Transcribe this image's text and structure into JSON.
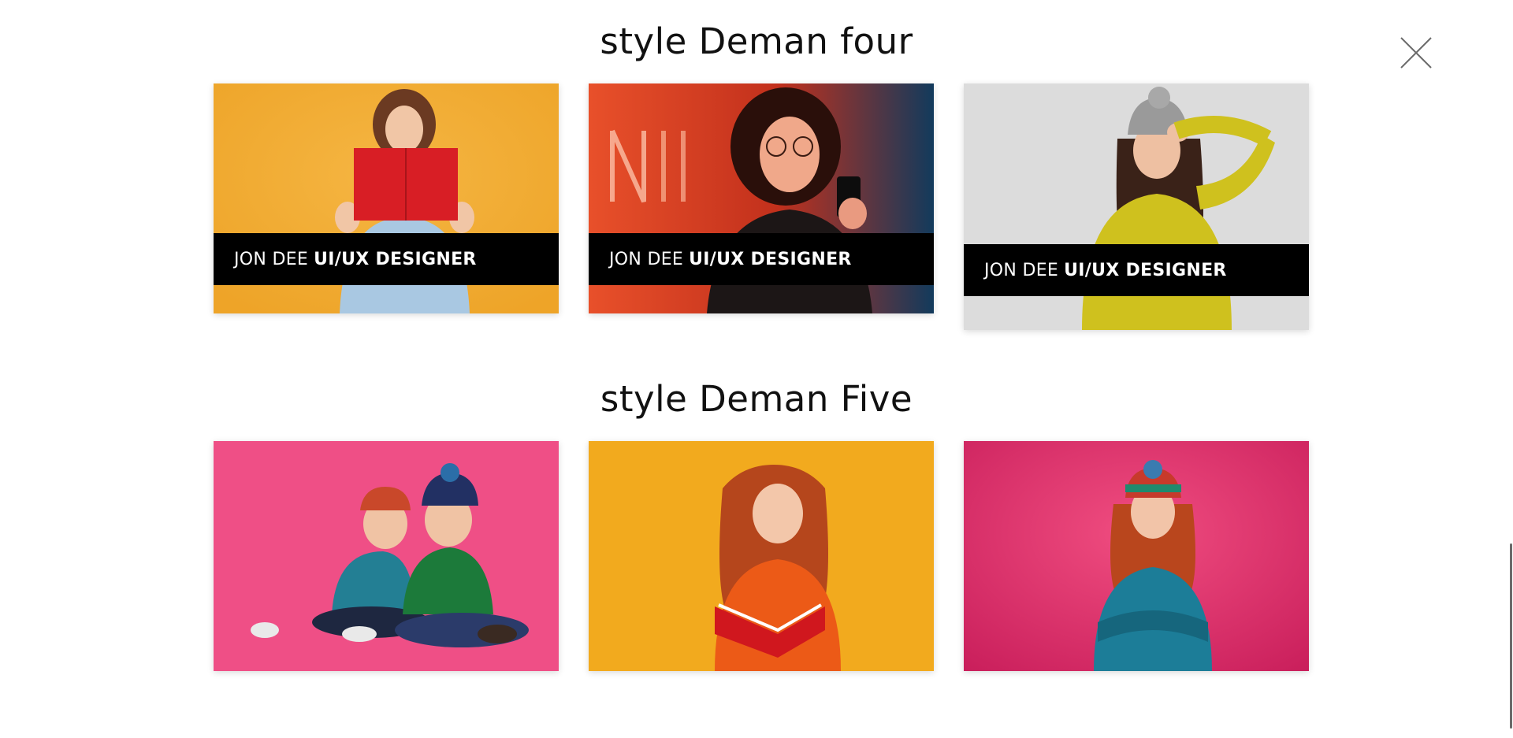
{
  "close_button": {
    "icon": "close-icon"
  },
  "sections": [
    {
      "title": "style Deman four",
      "cards": [
        {
          "caption_name": "JON DEE",
          "caption_role": "UI/UX DESIGNER",
          "bg": "#f2ac30",
          "subject": "woman holding red book"
        },
        {
          "caption_name": "JON DEE",
          "caption_role": "UI/UX DESIGNER",
          "bg": "#d4431f",
          "subject": "woman with glasses and phone in neon light"
        },
        {
          "caption_name": "JON DEE",
          "caption_role": "UI/UX DESIGNER",
          "bg": "#dcdcdc",
          "subject": "woman in yellow sweater and grey beanie"
        }
      ]
    },
    {
      "title": "style Deman Five",
      "cards": [
        {
          "bg": "#ef4f86",
          "subject": "two kids sitting in winter hats"
        },
        {
          "bg": "#f2aa1e",
          "subject": "red-haired girl holding red book"
        },
        {
          "bg": "#e0336b",
          "subject": "red-haired girl with arms crossed"
        }
      ]
    }
  ],
  "colors": {
    "caption_bg": "#000000",
    "caption_text": "#ffffff",
    "title_text": "#111111"
  }
}
